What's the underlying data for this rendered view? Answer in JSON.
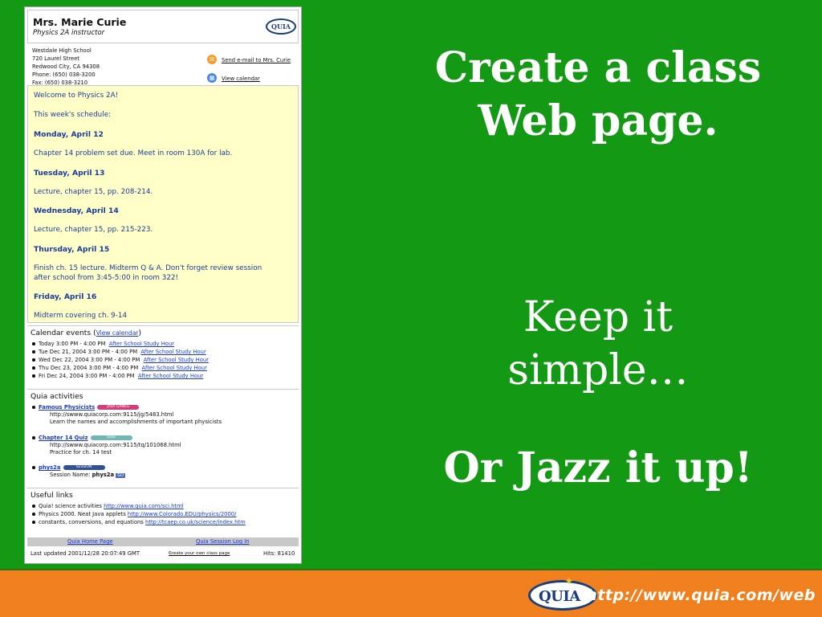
{
  "slide": {
    "heading_line1": "Create a class",
    "heading_line2": "Web page.",
    "keep_line1": "Keep it",
    "keep_line2": "simple…",
    "jazz": "Or Jazz it up!",
    "footer_url": "http://www.quia.com/web",
    "logo_text": "QUIA",
    "colors": {
      "background": "#139913",
      "footer": "#f07f1d",
      "text": "#ffffff"
    }
  },
  "classpage": {
    "teacher_name": "Mrs. Marie Curie",
    "teacher_role": "Physics 2A instructor",
    "logo_text": "QUIA",
    "address": [
      "Westdale High School",
      "720 Laurel Street",
      "Redwood City, CA 94308",
      "Phone: (650) 038-3200",
      "Fax: (650) 038-3210"
    ],
    "email_link": "Send e-mail to Mrs. Curie",
    "calendar_link": "View calendar",
    "schedule": [
      {
        "text": "Welcome to Physics 2A!",
        "day": false
      },
      {
        "text": "This week's schedule:",
        "day": false
      },
      {
        "text": "Monday, April 12",
        "day": true
      },
      {
        "text": "Chapter 14 problem set due.  Meet in room 130A for lab.",
        "day": false
      },
      {
        "text": "Tuesday, April 13",
        "day": true
      },
      {
        "text": "Lecture, chapter 15, pp. 208-214.",
        "day": false
      },
      {
        "text": "Wednesday, April 14",
        "day": true
      },
      {
        "text": "Lecture, chapter 15, pp. 215-223.",
        "day": false
      },
      {
        "text": "Thursday, April 15",
        "day": true
      },
      {
        "text": "Finish ch. 15 lecture.  Midterm Q & A.  Don't forget review session",
        "day": false
      },
      {
        "text": "after school from 3:45-5:00 in room 322!",
        "day": false
      },
      {
        "text": "Friday, April 16",
        "day": true
      },
      {
        "text": "Midterm covering ch. 9-14",
        "day": false
      }
    ],
    "calendar": {
      "title": "Calendar events (",
      "title_link": "View calendar",
      "title_end": ")",
      "events": [
        {
          "when": "Today  3:00 PM - 4:00 PM",
          "what": "After School Study Hour"
        },
        {
          "when": "Tue Dec 21, 2004  3:00 PM - 4:00 PM",
          "what": "After School Study Hour"
        },
        {
          "when": "Wed Dec 22, 2004  3:00 PM - 4:00 PM",
          "what": "After School Study Hour"
        },
        {
          "when": "Thu Dec 23, 2004  3:00 PM - 4:00 PM",
          "what": "After School Study Hour"
        },
        {
          "when": "Fri Dec 24, 2004  3:00 PM - 4:00 PM",
          "what": "After School Study Hour"
        }
      ]
    },
    "activities": {
      "title": "Quia activities",
      "items": [
        {
          "name": "Famous Physicists",
          "badge": "JAVA GAMES",
          "badge_color": "#d0407a",
          "url": "http://swww.quiacorp.com:9115/jg/5483.html",
          "desc": "Learn the names and accomplishments of important physicists"
        },
        {
          "name": "Chapter 14 Quiz",
          "badge": "QUIZ",
          "badge_color": "#70b8b8",
          "url": "http://swww.quiacorp.com:9115/tq/101068.html",
          "desc": "Practice for ch. 14 test"
        },
        {
          "name": "phys2a",
          "badge": "SESSION",
          "badge_color": "#30509a",
          "session_label": "Session Name:",
          "session_name": "phys2a",
          "go": "GO"
        }
      ]
    },
    "links": {
      "title": "Useful links",
      "items": [
        {
          "text": "Quia! science activities ",
          "url": "http://www.quia.com/sci.html"
        },
        {
          "text": "Physics 2000. Neat Java applets ",
          "url": "http://www.Colorado.EDU/physics/2000/"
        },
        {
          "text": "constants, conversions, and equations ",
          "url": "http://tcaep.co.uk/science/index.htm"
        }
      ]
    },
    "bottom": {
      "home": "Quia Home Page",
      "session": "Quia Session Log In",
      "updated": "Last updated 2001/12/28 20:07:49 GMT",
      "create": "Create your own class page",
      "hits": "Hits: 81410"
    }
  }
}
